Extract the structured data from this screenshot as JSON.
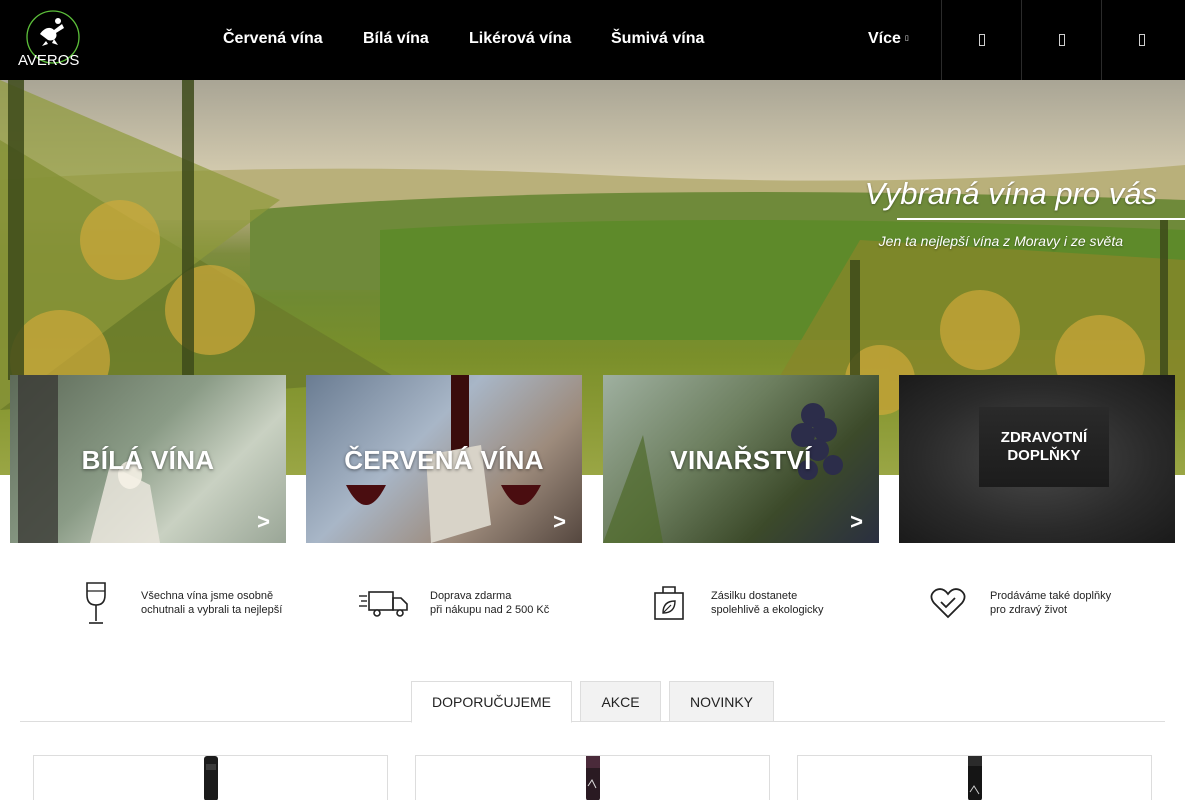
{
  "header": {
    "logo_text": "AVEROS",
    "nav": [
      "Červená vína",
      "Bílá vína",
      "Likérová vína",
      "Šumivá vína"
    ],
    "more_label": "Více"
  },
  "hero": {
    "title": "Vybraná vína pro vás",
    "subtitle": "Jen ta nejlepší vína z Moravy i ze světa"
  },
  "categories": [
    {
      "title": "BÍLÁ VÍNA",
      "arrow": ">"
    },
    {
      "title": "ČERVENÁ VÍNA",
      "arrow": ">"
    },
    {
      "title": "VINAŘSTVÍ",
      "arrow": ">"
    },
    {
      "title_line1": "ZDRAVOTNÍ",
      "title_line2": "DOPLŇKY"
    }
  ],
  "features": [
    {
      "line1": "Všechna vína jsme osobně",
      "line2": "ochutnali a vybrali ta nejlepší",
      "icon": "wine-glass-icon"
    },
    {
      "line1": "Doprava zdarma",
      "line2": "při nákupu nad 2 500 Kč",
      "icon": "truck-icon"
    },
    {
      "line1": "Zásilku dostanete",
      "line2": "spolehlivě a ekologicky",
      "icon": "eco-bag-icon"
    },
    {
      "line1": "Prodáváme také doplňky",
      "line2": "pro zdravý život",
      "icon": "heart-check-icon"
    }
  ],
  "tabs": [
    "DOPORUČUJEME",
    "AKCE",
    "NOVINKY"
  ],
  "colors": {
    "header_bg": "#000000",
    "text": "#222222",
    "tab_border": "#dddddd"
  }
}
